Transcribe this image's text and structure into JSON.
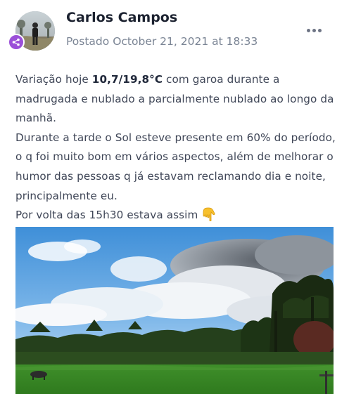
{
  "post": {
    "author": "Carlos Campos",
    "meta": {
      "prefix": "Postado",
      "date": "October 21, 2021 at 18:33"
    },
    "more_icon": "ellipsis-icon",
    "badge_icon": "share-icon",
    "body": {
      "line1_before": "Variação hoje ",
      "line1_bold": "10,7/19,8°C",
      "line1_after": " com garoa durante a madrugada e nublado a parcialmente nublado ao longo da manhã.",
      "paragraph2": "Durante a tarde o Sol esteve presente em 60% do período, o q foi muito bom em vários aspectos, além de melhorar o humor das pessoas q já estavam reclamando dia e noite, principalmente eu.",
      "paragraph3": "Por volta das 15h30 estava assim",
      "emoji_icon": "pointing-down-hand-icon"
    },
    "colors": {
      "badge": "#9b4fd8",
      "author": "#1c2230",
      "meta": "#7a8494"
    }
  }
}
